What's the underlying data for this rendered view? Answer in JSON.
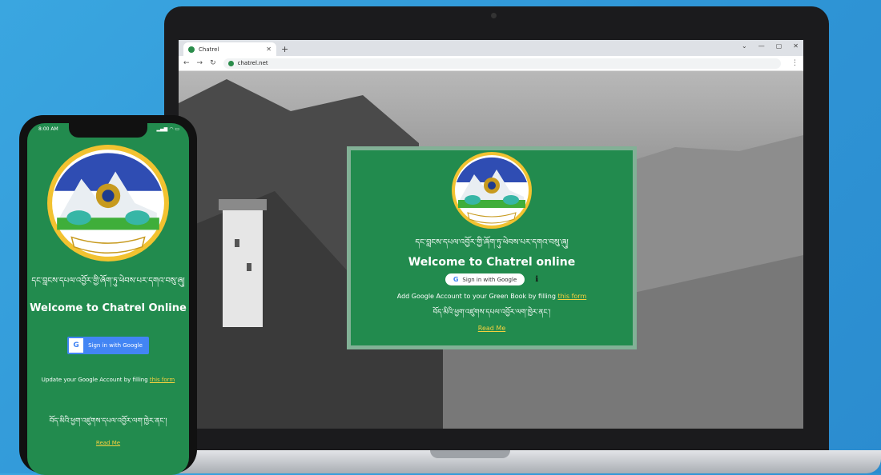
{
  "browser": {
    "tab_title": "Chatrel",
    "new_tab": "+",
    "url": "chatrel.net",
    "window_controls": [
      "⌄",
      "—",
      "▢",
      "✕"
    ]
  },
  "desktop_page": {
    "tibetan_line": "དང་བླངས་དཔལ་འབྱོར་གྱི་ཞོག་ཏུ་ཕེབས་པར་དགའ་བསུ་ཞུ།",
    "welcome": "Welcome to Chatrel online",
    "google_button": "Sign in with Google",
    "info_icon": "ℹ",
    "add_text": "Add Google Account to your Green Book by filling ",
    "form_link": "this form",
    "tibetan_line2": "བོད་མིའི་ཕྱག་འཛུགས་དཔལ་འབྱོར་ལག་ཁྱེར་ནང་།",
    "read_me": "Read Me"
  },
  "phone_page": {
    "time": "8:00 AM",
    "status_icons": "▂▄▆ ◠ ▭",
    "tibetan_line": "དང་བླངས་དཔལ་འབྱོར་གྱི་ཞོག་ཏུ་ཕེབས་པར་དགའ་བསུ་ཞུ།",
    "welcome": "Welcome to Chatrel Online",
    "google_button": "Sign in with Google",
    "update_text": "Update your Google Account by filling ",
    "form_link": "this form",
    "tibetan_line2": "བོད་མིའི་ཕྱག་འཛུགས་དཔལ་འབྱོར་ལག་ཁྱེར་ནང་།",
    "read_me": "Read Me"
  },
  "colors": {
    "brand_green": "#228b4e",
    "link_yellow": "#f4d03f",
    "background_blue": "#2f95d6"
  }
}
